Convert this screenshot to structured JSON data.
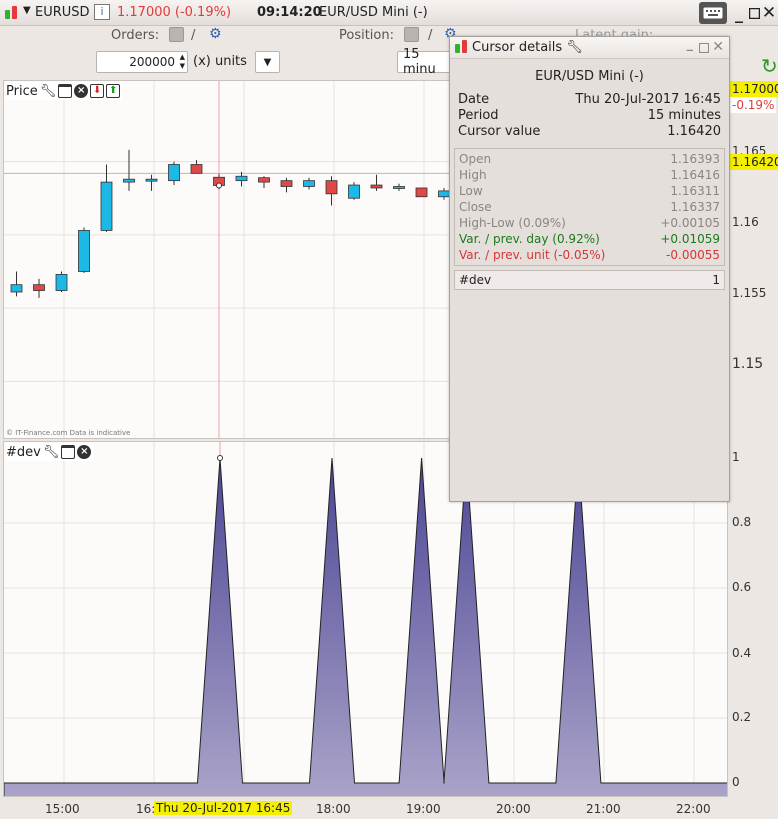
{
  "titlebar": {
    "symbol": "EURUSD",
    "price_change": "1.17000 (-0.19%)",
    "time": "09:14:20",
    "instrument": "EUR/USD Mini (-)"
  },
  "toolbar": {
    "orders_label": "Orders:",
    "orders_sep": "/",
    "position_label": "Position:",
    "position_sep": "/",
    "latent_label": "Latent gain:",
    "quantity_value": "200000",
    "units_value": "(x) units",
    "period_value": "15 minu"
  },
  "price_panel": {
    "label": "Price",
    "copyright": "© IT-Finance.com  Data is indicative"
  },
  "dev_panel": {
    "label": "#dev"
  },
  "axis": {
    "price_ticks": [
      "1.165",
      "1.16",
      "1.155",
      "1.15"
    ],
    "last_price": "1.17000",
    "last_change": "-0.19%",
    "cursor_price": "1.16420",
    "dev_ticks": [
      "1",
      "0.8",
      "0.6",
      "0.4",
      "0.2",
      "0"
    ]
  },
  "xaxis": {
    "labels": [
      "15:00",
      "16:",
      "18:00",
      "19:00",
      "20:00",
      "21:00",
      "22:00"
    ],
    "cursor_label": "Thu 20-Jul-2017 16:45"
  },
  "cursor_details": {
    "window_title": "Cursor details",
    "title": "EUR/USD Mini (-)",
    "date_label": "Date",
    "date_value": "Thu 20-Jul-2017 16:45",
    "period_label": "Period",
    "period_value": "15 minutes",
    "cursor_label": "Cursor value",
    "cursor_value": "1.16420",
    "open_label": "Open",
    "open_value": "1.16393",
    "high_label": "High",
    "high_value": "1.16416",
    "low_label": "Low",
    "low_value": "1.16311",
    "close_label": "Close",
    "close_value": "1.16337",
    "hl_label": "High-Low (0.09%)",
    "hl_value": "+0.00105",
    "var_day_label": "Var. / prev. day (0.92%)",
    "var_day_value": "+0.01059",
    "var_unit_label": "Var. / prev. unit (-0.05%)",
    "var_unit_value": "-0.00055",
    "dev_label": "#dev",
    "dev_value": "1"
  },
  "colors": {
    "bull": "#1cb8e8",
    "bear": "#e04848",
    "dev_fill": "#6a64a8",
    "cursor_line": "#f0a0a0",
    "highlight": "#f5f000"
  },
  "chart_data": [
    {
      "type": "candlestick",
      "ylim": [
        1.146,
        1.1705
      ],
      "candles": [
        {
          "o": 1.1561,
          "h": 1.1575,
          "l": 1.1558,
          "c": 1.1566
        },
        {
          "o": 1.1566,
          "h": 1.157,
          "l": 1.1557,
          "c": 1.1562
        },
        {
          "o": 1.1562,
          "h": 1.1575,
          "l": 1.1561,
          "c": 1.1573
        },
        {
          "o": 1.1575,
          "h": 1.1605,
          "l": 1.1574,
          "c": 1.1603
        },
        {
          "o": 1.1603,
          "h": 1.1648,
          "l": 1.1602,
          "c": 1.1636
        },
        {
          "o": 1.1636,
          "h": 1.1658,
          "l": 1.163,
          "c": 1.1638
        },
        {
          "o": 1.1637,
          "h": 1.1641,
          "l": 1.163,
          "c": 1.1638
        },
        {
          "o": 1.1637,
          "h": 1.165,
          "l": 1.1634,
          "c": 1.1648
        },
        {
          "o": 1.1648,
          "h": 1.1651,
          "l": 1.1642,
          "c": 1.1642
        },
        {
          "o": 1.16393,
          "h": 1.16416,
          "l": 1.16311,
          "c": 1.16337
        },
        {
          "o": 1.1637,
          "h": 1.1643,
          "l": 1.1633,
          "c": 1.164
        },
        {
          "o": 1.1639,
          "h": 1.164,
          "l": 1.1632,
          "c": 1.1636
        },
        {
          "o": 1.1637,
          "h": 1.1639,
          "l": 1.1629,
          "c": 1.1633
        },
        {
          "o": 1.1633,
          "h": 1.1639,
          "l": 1.1631,
          "c": 1.1637
        },
        {
          "o": 1.1637,
          "h": 1.164,
          "l": 1.162,
          "c": 1.1628
        },
        {
          "o": 1.1625,
          "h": 1.1636,
          "l": 1.1624,
          "c": 1.1634
        },
        {
          "o": 1.1634,
          "h": 1.1641,
          "l": 1.163,
          "c": 1.1632
        },
        {
          "o": 1.1632,
          "h": 1.1635,
          "l": 1.163,
          "c": 1.1633
        },
        {
          "o": 1.1632,
          "h": 1.1632,
          "l": 1.1626,
          "c": 1.1626
        },
        {
          "o": 1.1626,
          "h": 1.1632,
          "l": 1.1624,
          "c": 1.163
        }
      ]
    },
    {
      "type": "area",
      "ylim": [
        0,
        1
      ],
      "peaks": [
        4.9,
        7.4,
        9.4,
        10.4,
        12.9
      ],
      "baseline": 0
    }
  ]
}
